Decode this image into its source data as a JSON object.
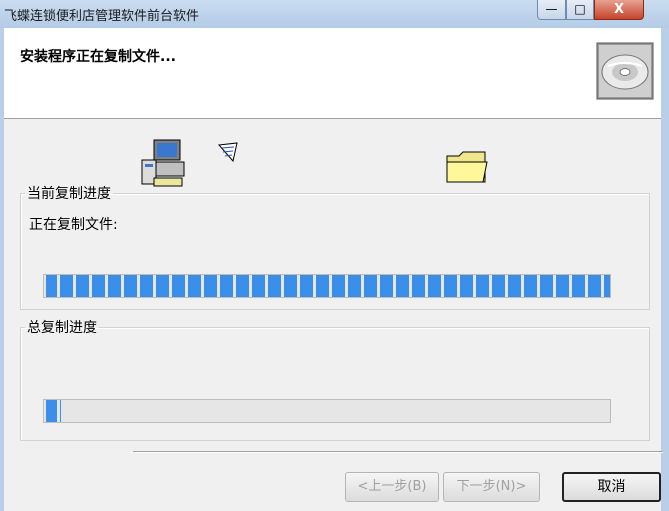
{
  "window": {
    "title": "飞蝶连锁便利店管理软件前台软件",
    "minimize": "—",
    "maximize": "□",
    "close": "X"
  },
  "header": {
    "title": "安装程序正在复制文件..."
  },
  "current_group": {
    "legend": "当前复制进度",
    "status": "正在复制文件:",
    "progress": 1.0
  },
  "total_group": {
    "legend": "总复制进度",
    "progress": 0.03
  },
  "buttons": {
    "back": "<上一步(B)",
    "next": "下一步(N)>",
    "cancel": "取消"
  },
  "icons": [
    "cd-disc-icon",
    "computer-icon",
    "flying-paper-icon",
    "folder-icon"
  ]
}
